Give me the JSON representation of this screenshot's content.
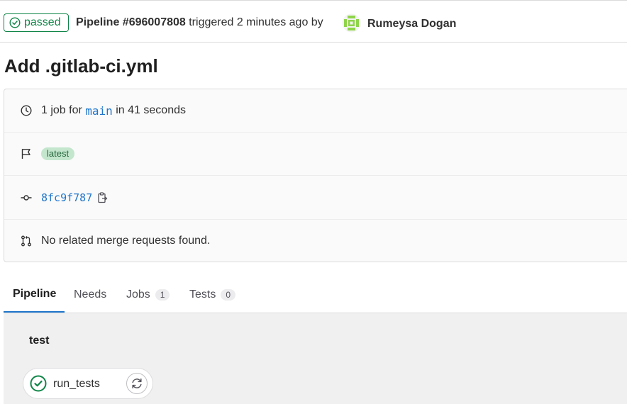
{
  "header": {
    "status": "passed",
    "pipeline_label": "Pipeline #696007808",
    "triggered_text": "triggered 2 minutes ago by",
    "author": "Rumeysa Dogan"
  },
  "title": "Add .gitlab-ci.yml",
  "info": {
    "jobs_prefix": "1 job for",
    "branch": "main",
    "duration": "in 41 seconds",
    "latest_badge": "latest",
    "commit_sha": "8fc9f787",
    "merge_requests": "No related merge requests found."
  },
  "tabs": [
    {
      "label": "Pipeline"
    },
    {
      "label": "Needs"
    },
    {
      "label": "Jobs",
      "count": "1"
    },
    {
      "label": "Tests",
      "count": "0"
    }
  ],
  "graph": {
    "stage": "test",
    "job_name": "run_tests"
  },
  "colors": {
    "success": "#108548",
    "link": "#1f75cb"
  }
}
